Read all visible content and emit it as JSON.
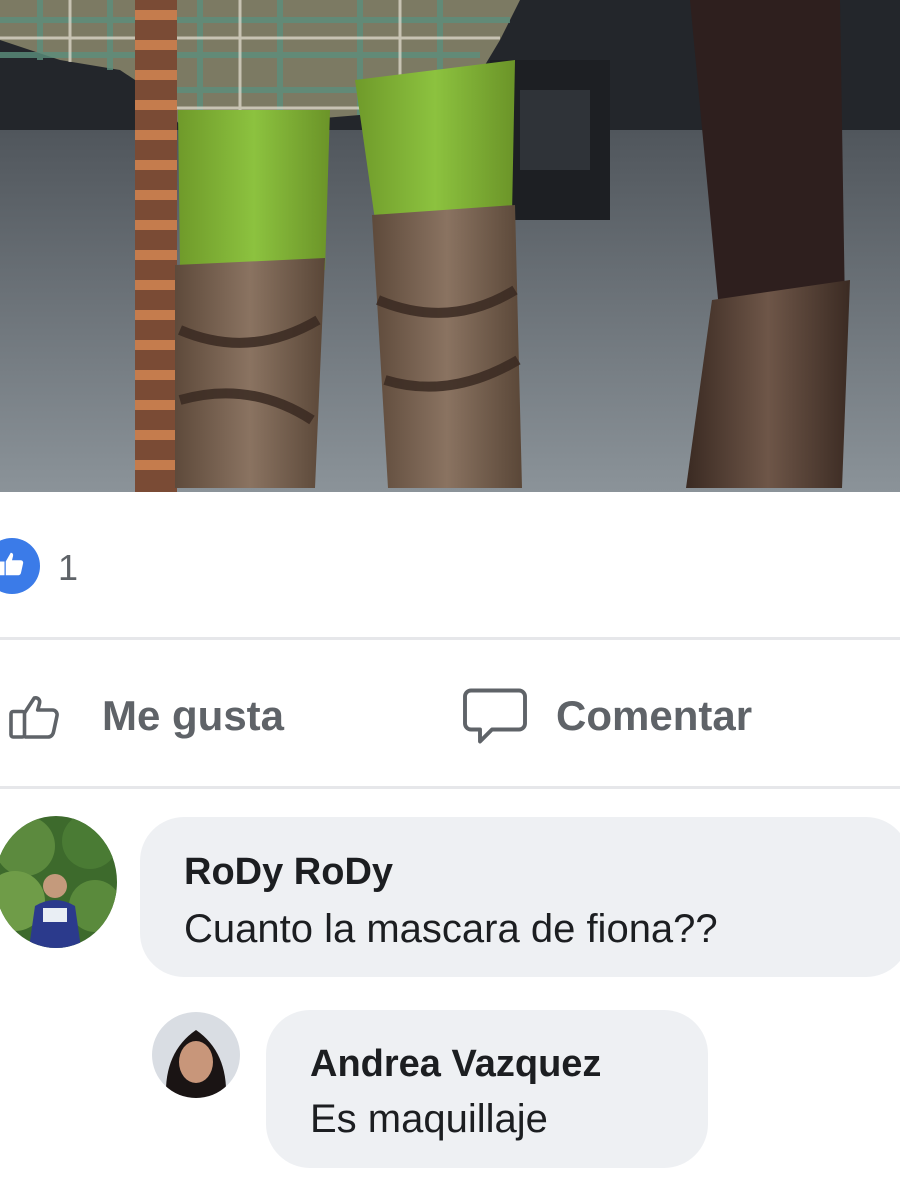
{
  "post": {
    "reactions": {
      "icon": "thumbs-up-icon",
      "badge_color": "#3b7be8",
      "count": "1"
    },
    "actions": {
      "like_label": "Me gusta",
      "like_icon": "thumbs-up-outline-icon",
      "comment_label": "Comentar",
      "comment_icon": "speech-bubble-icon"
    }
  },
  "comments": [
    {
      "author": "RoDy RoDy",
      "text": "Cuanto la mascara de fiona??"
    }
  ],
  "replies": [
    {
      "author": "Andrea Vazquez",
      "text": "Es maquillaje"
    }
  ]
}
